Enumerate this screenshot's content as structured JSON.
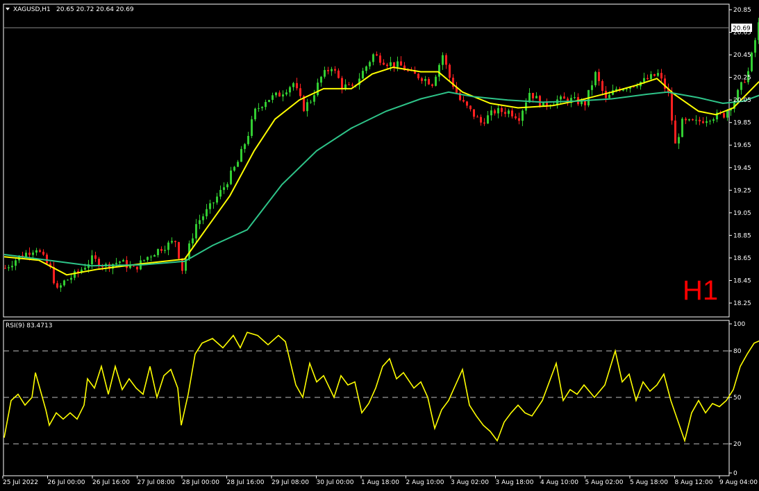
{
  "chart_data": [
    {
      "type": "candlestick",
      "title": "XAGUSD,H1",
      "ohlc_readout": "20.65 20.72 20.64 20.69",
      "timeframe_label": "H1",
      "current_price": 20.69,
      "current_price_label": "20.69",
      "ylim": [
        18.18,
        20.9
      ],
      "y_ticks": [
        "20.85",
        "20.65",
        "20.45",
        "20.25",
        "20.05",
        "19.85",
        "19.65",
        "19.45",
        "19.25",
        "19.05",
        "18.85",
        "18.65",
        "18.45",
        "18.25"
      ],
      "x_ticks": [
        "25 Jul 2022",
        "26 Jul 00:00",
        "26 Jul 16:00",
        "27 Jul 08:00",
        "28 Jul 00:00",
        "28 Jul 16:00",
        "29 Jul 08:00",
        "30 Jul 00:00",
        "1 Aug 18:00",
        "2 Aug 10:00",
        "3 Aug 02:00",
        "3 Aug 18:00",
        "4 Aug 10:00",
        "5 Aug 02:00",
        "5 Aug 18:00",
        "8 Aug 12:00",
        "9 Aug 04:00"
      ],
      "close_path": [
        [
          0,
          18.56
        ],
        [
          4,
          18.66
        ],
        [
          9,
          18.74
        ],
        [
          13,
          18.55
        ],
        [
          15,
          18.36
        ],
        [
          17,
          18.44
        ],
        [
          21,
          18.52
        ],
        [
          25,
          18.64
        ],
        [
          29,
          18.58
        ],
        [
          33,
          18.62
        ],
        [
          37,
          18.55
        ],
        [
          41,
          18.66
        ],
        [
          45,
          18.74
        ],
        [
          49,
          18.8
        ],
        [
          51,
          18.55
        ],
        [
          55,
          18.95
        ],
        [
          59,
          19.1
        ],
        [
          63,
          19.28
        ],
        [
          67,
          19.5
        ],
        [
          70,
          19.75
        ],
        [
          72,
          19.95
        ],
        [
          75,
          20.05
        ],
        [
          79,
          20.1
        ],
        [
          83,
          20.2
        ],
        [
          86,
          19.98
        ],
        [
          88,
          20.05
        ],
        [
          91,
          20.25
        ],
        [
          94,
          20.35
        ],
        [
          97,
          20.18
        ],
        [
          100,
          20.15
        ],
        [
          103,
          20.3
        ],
        [
          106,
          20.45
        ],
        [
          110,
          20.38
        ],
        [
          114,
          20.35
        ],
        [
          117,
          20.28
        ],
        [
          120,
          20.25
        ],
        [
          123,
          20.2
        ],
        [
          126,
          20.45
        ],
        [
          128,
          20.25
        ],
        [
          131,
          20.05
        ],
        [
          134,
          19.95
        ],
        [
          137,
          19.85
        ],
        [
          141,
          19.95
        ],
        [
          145,
          19.95
        ],
        [
          148,
          19.9
        ],
        [
          151,
          20.12
        ],
        [
          155,
          20.0
        ],
        [
          159,
          20.05
        ],
        [
          163,
          20.05
        ],
        [
          167,
          20.02
        ],
        [
          170,
          20.28
        ],
        [
          173,
          20.05
        ],
        [
          176,
          20.15
        ],
        [
          180,
          20.18
        ],
        [
          184,
          20.22
        ],
        [
          188,
          20.28
        ],
        [
          191,
          20.1
        ],
        [
          193,
          19.65
        ],
        [
          195,
          19.85
        ],
        [
          199,
          19.85
        ],
        [
          203,
          19.9
        ],
        [
          207,
          19.92
        ],
        [
          210,
          20.05
        ],
        [
          214,
          20.3
        ],
        [
          217,
          20.72
        ],
        [
          219,
          20.62
        ],
        [
          222,
          20.66
        ],
        [
          225,
          20.69
        ]
      ],
      "series": [
        {
          "name": "",
          "color": "#ffff00",
          "values": [
            [
              0,
              18.66
            ],
            [
              10,
              18.63
            ],
            [
              18,
              18.5
            ],
            [
              27,
              18.55
            ],
            [
              40,
              18.6
            ],
            [
              52,
              18.64
            ],
            [
              58,
              18.9
            ],
            [
              65,
              19.2
            ],
            [
              72,
              19.6
            ],
            [
              78,
              19.88
            ],
            [
              85,
              20.05
            ],
            [
              92,
              20.15
            ],
            [
              100,
              20.15
            ],
            [
              106,
              20.28
            ],
            [
              112,
              20.34
            ],
            [
              120,
              20.3
            ],
            [
              125,
              20.3
            ],
            [
              132,
              20.12
            ],
            [
              140,
              20.02
            ],
            [
              148,
              19.98
            ],
            [
              158,
              20.0
            ],
            [
              166,
              20.05
            ],
            [
              175,
              20.12
            ],
            [
              182,
              20.18
            ],
            [
              188,
              20.24
            ],
            [
              193,
              20.1
            ],
            [
              200,
              19.95
            ],
            [
              205,
              19.92
            ],
            [
              210,
              19.98
            ],
            [
              217,
              20.2
            ],
            [
              225,
              20.42
            ]
          ]
        },
        {
          "name": "",
          "color": "#2ec489",
          "values": [
            [
              0,
              18.68
            ],
            [
              10,
              18.64
            ],
            [
              25,
              18.58
            ],
            [
              40,
              18.59
            ],
            [
              52,
              18.62
            ],
            [
              60,
              18.76
            ],
            [
              70,
              18.9
            ],
            [
              80,
              19.3
            ],
            [
              90,
              19.6
            ],
            [
              100,
              19.8
            ],
            [
              110,
              19.95
            ],
            [
              120,
              20.06
            ],
            [
              128,
              20.12
            ],
            [
              135,
              20.08
            ],
            [
              145,
              20.05
            ],
            [
              155,
              20.03
            ],
            [
              165,
              20.04
            ],
            [
              175,
              20.06
            ],
            [
              185,
              20.1
            ],
            [
              191,
              20.12
            ],
            [
              200,
              20.07
            ],
            [
              207,
              20.02
            ],
            [
              213,
              20.04
            ],
            [
              220,
              20.12
            ],
            [
              225,
              20.2
            ]
          ]
        }
      ]
    },
    {
      "type": "line",
      "title": "RSI(9) 83.4713",
      "ylim": [
        0,
        100
      ],
      "y_ticks": [
        "100",
        "80",
        "50",
        "20",
        "0"
      ],
      "levels": [
        80,
        50,
        20
      ],
      "line_color": "#ffff00",
      "values": [
        [
          0,
          24
        ],
        [
          2,
          48
        ],
        [
          4,
          52
        ],
        [
          6,
          45
        ],
        [
          8,
          50
        ],
        [
          9,
          66
        ],
        [
          10,
          58
        ],
        [
          12,
          42
        ],
        [
          13,
          32
        ],
        [
          15,
          40
        ],
        [
          17,
          36
        ],
        [
          19,
          40
        ],
        [
          21,
          36
        ],
        [
          23,
          45
        ],
        [
          24,
          62
        ],
        [
          26,
          56
        ],
        [
          28,
          70
        ],
        [
          30,
          52
        ],
        [
          32,
          70
        ],
        [
          34,
          55
        ],
        [
          36,
          62
        ],
        [
          38,
          56
        ],
        [
          40,
          52
        ],
        [
          42,
          70
        ],
        [
          44,
          50
        ],
        [
          46,
          64
        ],
        [
          48,
          68
        ],
        [
          50,
          56
        ],
        [
          51,
          32
        ],
        [
          53,
          52
        ],
        [
          55,
          78
        ],
        [
          57,
          85
        ],
        [
          60,
          88
        ],
        [
          63,
          82
        ],
        [
          66,
          90
        ],
        [
          68,
          82
        ],
        [
          70,
          92
        ],
        [
          73,
          90
        ],
        [
          76,
          84
        ],
        [
          79,
          90
        ],
        [
          81,
          86
        ],
        [
          84,
          58
        ],
        [
          86,
          50
        ],
        [
          88,
          72
        ],
        [
          90,
          60
        ],
        [
          92,
          64
        ],
        [
          95,
          50
        ],
        [
          97,
          64
        ],
        [
          99,
          58
        ],
        [
          101,
          60
        ],
        [
          103,
          40
        ],
        [
          105,
          46
        ],
        [
          107,
          56
        ],
        [
          109,
          70
        ],
        [
          111,
          75
        ],
        [
          113,
          62
        ],
        [
          115,
          66
        ],
        [
          118,
          56
        ],
        [
          120,
          60
        ],
        [
          122,
          50
        ],
        [
          124,
          30
        ],
        [
          126,
          42
        ],
        [
          128,
          48
        ],
        [
          130,
          58
        ],
        [
          132,
          68
        ],
        [
          134,
          45
        ],
        [
          136,
          38
        ],
        [
          138,
          32
        ],
        [
          140,
          28
        ],
        [
          142,
          22
        ],
        [
          144,
          34
        ],
        [
          146,
          40
        ],
        [
          148,
          45
        ],
        [
          150,
          40
        ],
        [
          152,
          38
        ],
        [
          155,
          48
        ],
        [
          157,
          60
        ],
        [
          159,
          72
        ],
        [
          161,
          48
        ],
        [
          163,
          55
        ],
        [
          165,
          52
        ],
        [
          167,
          58
        ],
        [
          170,
          50
        ],
        [
          173,
          58
        ],
        [
          176,
          80
        ],
        [
          178,
          60
        ],
        [
          180,
          65
        ],
        [
          182,
          48
        ],
        [
          184,
          60
        ],
        [
          186,
          54
        ],
        [
          188,
          58
        ],
        [
          190,
          65
        ],
        [
          192,
          48
        ],
        [
          194,
          35
        ],
        [
          196,
          22
        ],
        [
          198,
          40
        ],
        [
          200,
          48
        ],
        [
          202,
          40
        ],
        [
          204,
          46
        ],
        [
          206,
          44
        ],
        [
          208,
          48
        ],
        [
          210,
          55
        ],
        [
          212,
          70
        ],
        [
          214,
          78
        ],
        [
          216,
          85
        ],
        [
          218,
          87
        ],
        [
          220,
          84
        ],
        [
          222,
          82
        ],
        [
          225,
          84
        ]
      ]
    }
  ]
}
